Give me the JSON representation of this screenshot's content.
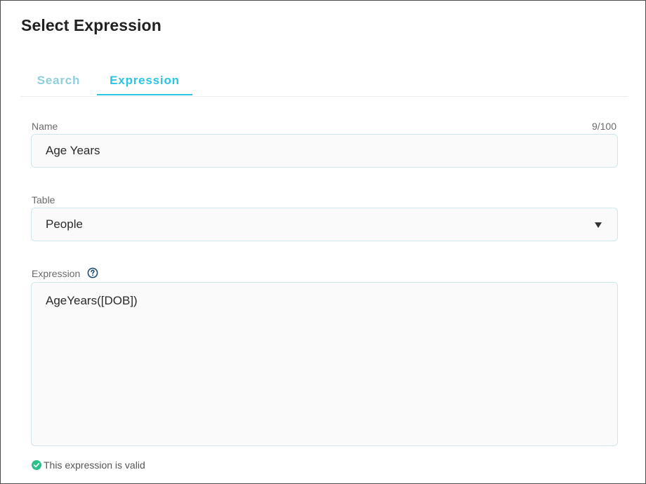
{
  "dialog": {
    "title": "Select Expression"
  },
  "tabs": [
    {
      "label": "Search",
      "active": false
    },
    {
      "label": "Expression",
      "active": true
    }
  ],
  "name": {
    "label": "Name",
    "value": "Age Years",
    "counter": "9/100"
  },
  "table": {
    "label": "Table",
    "value": "People"
  },
  "expression": {
    "label": "Expression",
    "value": "AgeYears([DOB])"
  },
  "validation": {
    "message": "This expression is valid"
  },
  "colors": {
    "accent": "#2bc4e4",
    "tab_inactive": "#8ecfdc",
    "valid": "#2fbf8a"
  },
  "icons": {
    "help": "help-circle-icon",
    "dropdown": "caret-down-icon",
    "valid": "check-circle-icon"
  }
}
